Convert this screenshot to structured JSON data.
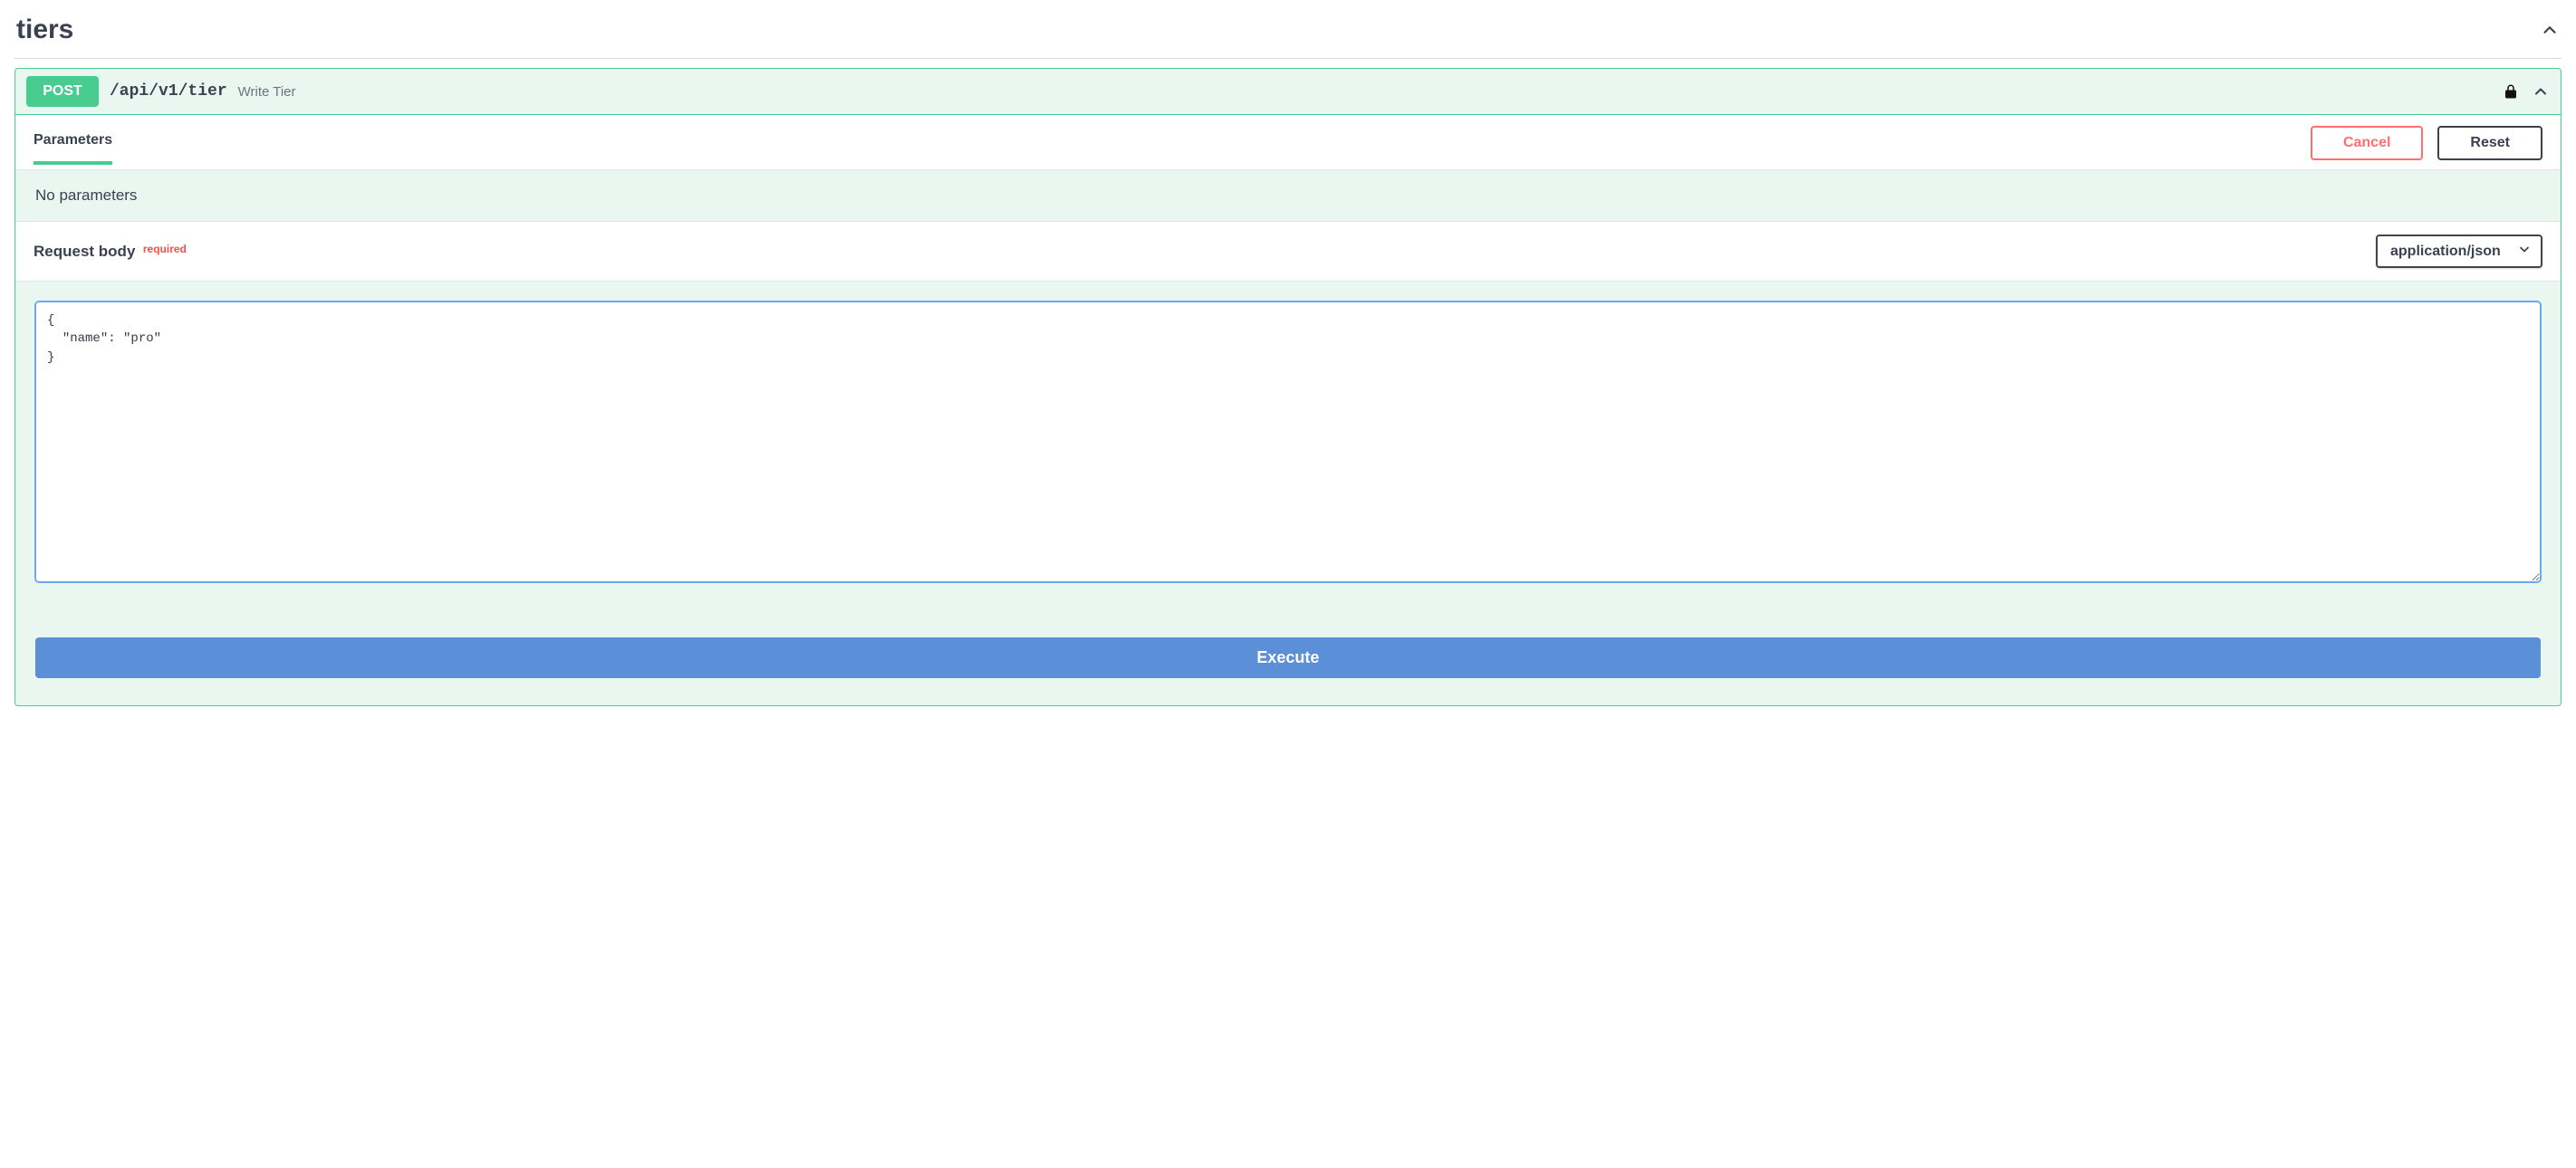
{
  "group": {
    "title": "tiers"
  },
  "op": {
    "method": "POST",
    "path": "/api/v1/tier",
    "summary": "Write Tier"
  },
  "parameters": {
    "title": "Parameters",
    "cancel_label": "Cancel",
    "reset_label": "Reset",
    "empty_message": "No parameters"
  },
  "request_body": {
    "title": "Request body",
    "required_label": "required",
    "content_type": "application/json",
    "body_value": "{\n  \"name\": \"pro\"\n}"
  },
  "actions": {
    "execute_label": "Execute"
  }
}
